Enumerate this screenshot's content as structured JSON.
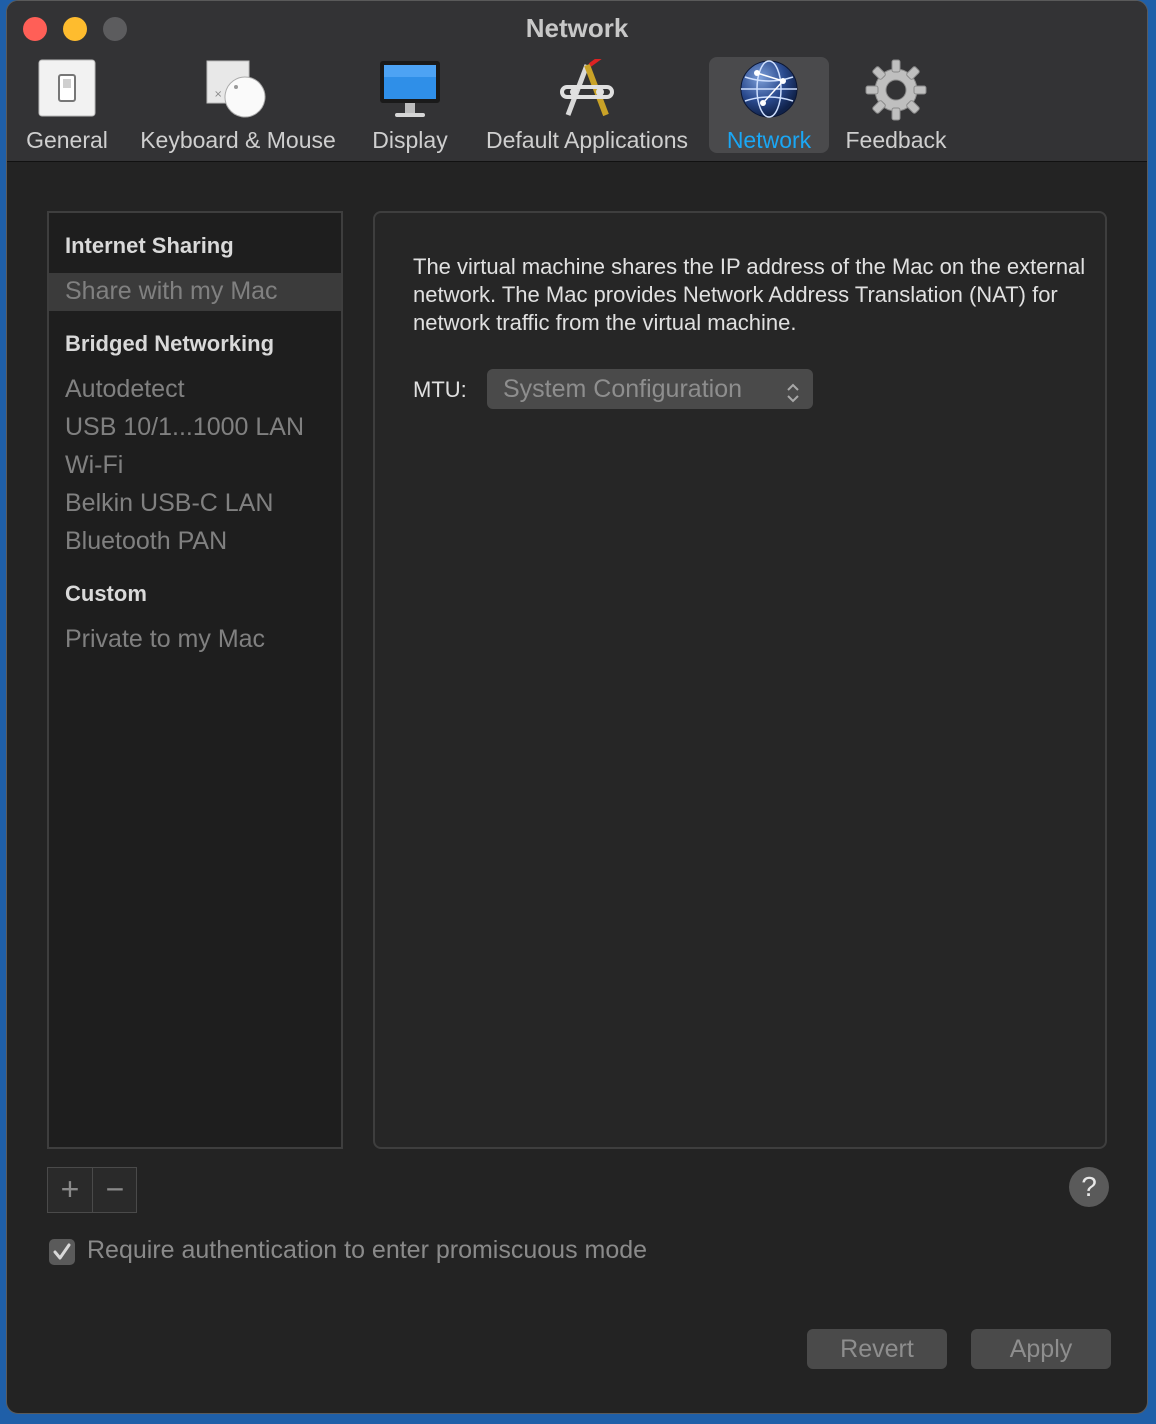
{
  "window": {
    "title": "Network",
    "traffic_lights": {
      "close": "#ff5f57",
      "minimize": "#febc2e",
      "zoom": "#5c5c5e"
    }
  },
  "toolbar": {
    "active_color": "#1aa7f5",
    "items": [
      {
        "label": "General",
        "icon": "switch-icon"
      },
      {
        "label": "Keyboard & Mouse",
        "icon": "mouse-icon"
      },
      {
        "label": "Display",
        "icon": "monitor-icon"
      },
      {
        "label": "Default Applications",
        "icon": "app-tools-icon"
      },
      {
        "label": "Network",
        "icon": "globe-icon",
        "active": true
      },
      {
        "label": "Feedback",
        "icon": "gear-icon"
      }
    ]
  },
  "sidebar": {
    "groups": [
      {
        "header": "Internet Sharing",
        "items": [
          "Share with my Mac"
        ]
      },
      {
        "header": "Bridged Networking",
        "items": [
          "Autodetect",
          "USB 10/1...1000 LAN",
          "Wi-Fi",
          "Belkin USB-C LAN",
          "Bluetooth PAN"
        ]
      },
      {
        "header": "Custom",
        "items": [
          "Private to my Mac"
        ]
      }
    ],
    "selected": "Share with my Mac"
  },
  "panel": {
    "description": "The virtual machine shares the IP address of the Mac on the external network. The Mac provides Network Address Translation (NAT) for network traffic from the virtual machine.",
    "mtu_label": "MTU:",
    "mtu_value": "System Configuration"
  },
  "list_controls": {
    "add": "+",
    "remove": "−"
  },
  "help": {
    "label": "?"
  },
  "promiscuous": {
    "label": "Require authentication to enter promiscuous mode",
    "checked": true
  },
  "buttons": {
    "revert": "Revert",
    "apply": "Apply"
  }
}
